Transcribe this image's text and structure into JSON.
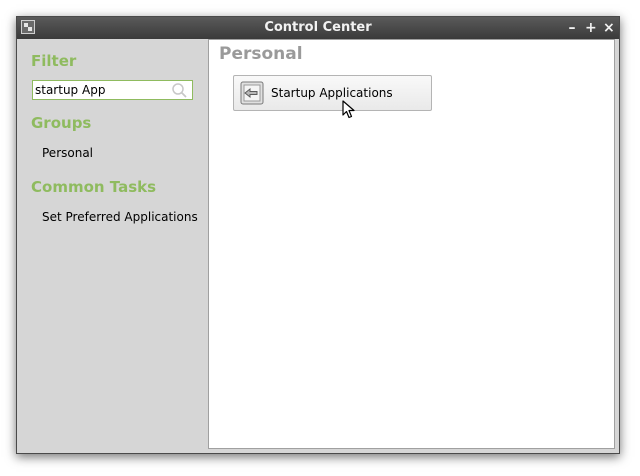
{
  "window": {
    "title": "Control Center",
    "controls": {
      "minimize": "–",
      "maximize": "+",
      "close": "×"
    }
  },
  "sidebar": {
    "filter_heading": "Filter",
    "search": {
      "value": "startup App",
      "placeholder": ""
    },
    "groups_heading": "Groups",
    "groups": [
      {
        "label": "Personal"
      }
    ],
    "tasks_heading": "Common Tasks",
    "tasks": [
      {
        "label": "Set Preferred Applications"
      }
    ]
  },
  "main": {
    "heading": "Personal",
    "items": [
      {
        "label": "Startup Applications",
        "icon": "startup-applications-icon"
      }
    ]
  },
  "colors": {
    "accent": "#8fbb5f",
    "titlebar": "#3a3a3a",
    "sidebar_bg": "#d6d6d6",
    "main_heading": "#9a9a9a"
  }
}
